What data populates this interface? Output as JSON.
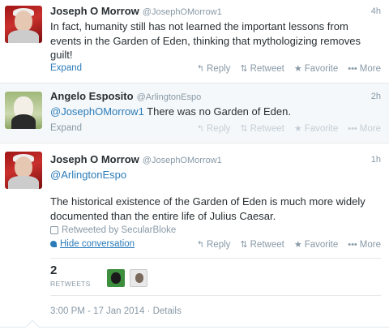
{
  "tweets": [
    {
      "name": "Joseph O Morrow",
      "handle": "@JosephOMorrow1",
      "time": "4h",
      "text": "In fact, humanity still has not learned the important lessons from events in the Garden of Eden, thinking that mythologizing removes guilt!",
      "expand": "Expand",
      "actions": {
        "reply": "Reply",
        "retweet": "Retweet",
        "favorite": "Favorite",
        "more": "More"
      }
    },
    {
      "name": "Angelo Esposito",
      "handle": "@ArlingtonEspo",
      "time": "2h",
      "mention": "@JosephOMorrow1",
      "text": " There was no Garden of Eden.",
      "expand": "Expand",
      "actions": {
        "reply": "Reply",
        "retweet": "Retweet",
        "favorite": "Favorite",
        "more": "More"
      }
    },
    {
      "name": "Joseph O Morrow",
      "handle": "@JosephOMorrow1",
      "time": "1h",
      "mention": "@ArlingtonEspo",
      "text": "The historical existence of the Garden of Eden is much more widely documented than the entire life of Julius Caesar.",
      "retweeted_by": "Retweeted by SecularBloke",
      "hide_conversation": "Hide conversation",
      "actions": {
        "reply": "Reply",
        "retweet": "Retweet",
        "favorite": "Favorite",
        "more": "More"
      },
      "retweet_count": "2",
      "retweets_label": "RETWEETS",
      "timestamp": "3:00 PM - 17 Jan 2014 · Details"
    }
  ],
  "icons": {
    "reply": "reply-arrow-icon",
    "retweet": "retweet-icon",
    "favorite": "star-icon",
    "more": "ellipsis-icon"
  },
  "colors": {
    "link": "#2b7bb9",
    "muted": "#8899a6",
    "text": "#292f33"
  }
}
